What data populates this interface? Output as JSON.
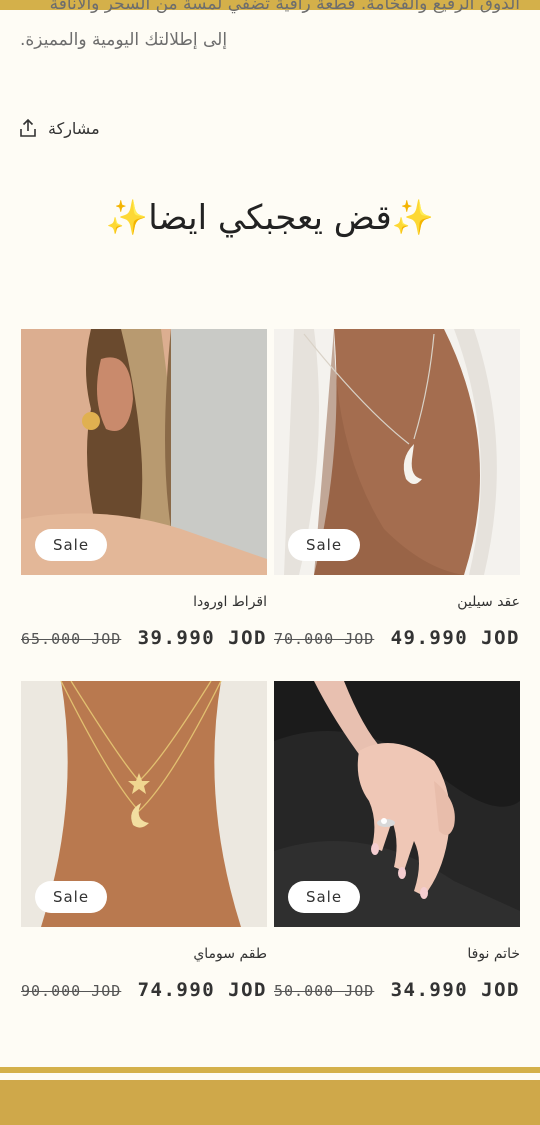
{
  "description": {
    "line1": "الذوق الرفيع والفخامة. قطعة راقية تضفي لمسة من السحر والأناقة",
    "line2": "إلى إطلالتك اليومية والمميزة."
  },
  "share": {
    "label": "مشاركة",
    "icon": "share-icon"
  },
  "section_title": "✨قض يعجبكي ايضا✨",
  "products": [
    {
      "name": "اقراط اورودا",
      "sale_badge": "Sale",
      "price": "39.990 JOD",
      "old_price": "65.000 JOD"
    },
    {
      "name": "عقد سيلين",
      "sale_badge": "Sale",
      "price": "49.990 JOD",
      "old_price": "70.000 JOD"
    },
    {
      "name": "طقم سوماي",
      "sale_badge": "Sale",
      "price": "74.990 JOD",
      "old_price": "90.000 JOD"
    },
    {
      "name": "خاتم نوفا",
      "sale_badge": "Sale",
      "price": "34.990 JOD",
      "old_price": "50.000 JOD"
    }
  ],
  "colors": {
    "accent": "#d4b04a",
    "background": "#fefcf5"
  }
}
